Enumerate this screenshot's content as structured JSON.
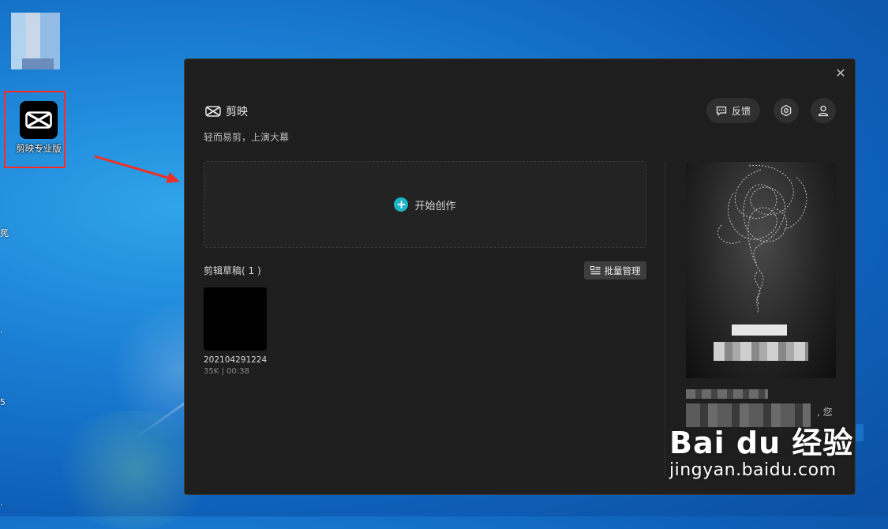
{
  "desktop": {
    "app_icon_label": "剪映专业版",
    "edge_chars": [
      "筅",
      ".",
      "5",
      "."
    ]
  },
  "window": {
    "brand_name": "剪映",
    "tagline": "轻而易剪，上演大幕",
    "feedback_label": "反馈",
    "create_label": "开始创作",
    "drafts_title": "剪辑草稿( 1 )",
    "batch_label": "批量管理",
    "draft": {
      "name": "202104291224",
      "meta": "35K | 00:38"
    },
    "promo_partial_text": ", 您"
  },
  "watermark": {
    "line1": "Bai du 经验",
    "line2": "jingyan.baidu.com"
  },
  "colors": {
    "accent": "#1cb5c8",
    "highlight_box": "#ff2a2a",
    "window_bg": "#1e1e1e"
  },
  "icons": [
    "capcut-logo-icon",
    "feedback-icon",
    "settings-icon",
    "user-icon",
    "close-icon",
    "plus-icon",
    "batch-icon",
    "arrow-icon"
  ]
}
